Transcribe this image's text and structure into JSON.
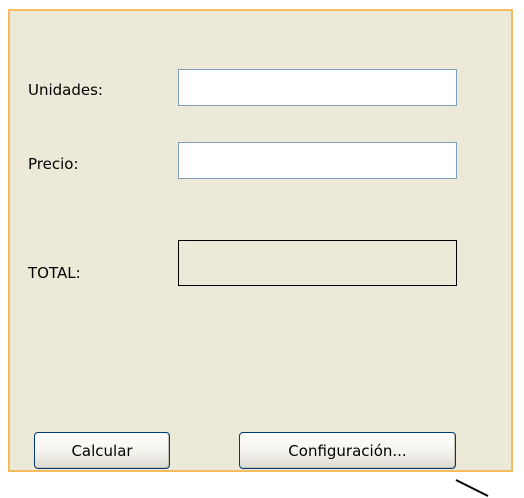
{
  "form": {
    "units_label": "Unidades:",
    "units_value": "",
    "price_label": "Precio:",
    "price_value": "",
    "total_label": "TOTAL:",
    "total_value": ""
  },
  "buttons": {
    "calculate_label": "Calcular",
    "settings_label": "Configuración..."
  },
  "colors": {
    "panel_background": "#ece9d8",
    "panel_border": "#f5bb5e",
    "field_border": "#7f9db9",
    "button_border": "#003c74"
  }
}
